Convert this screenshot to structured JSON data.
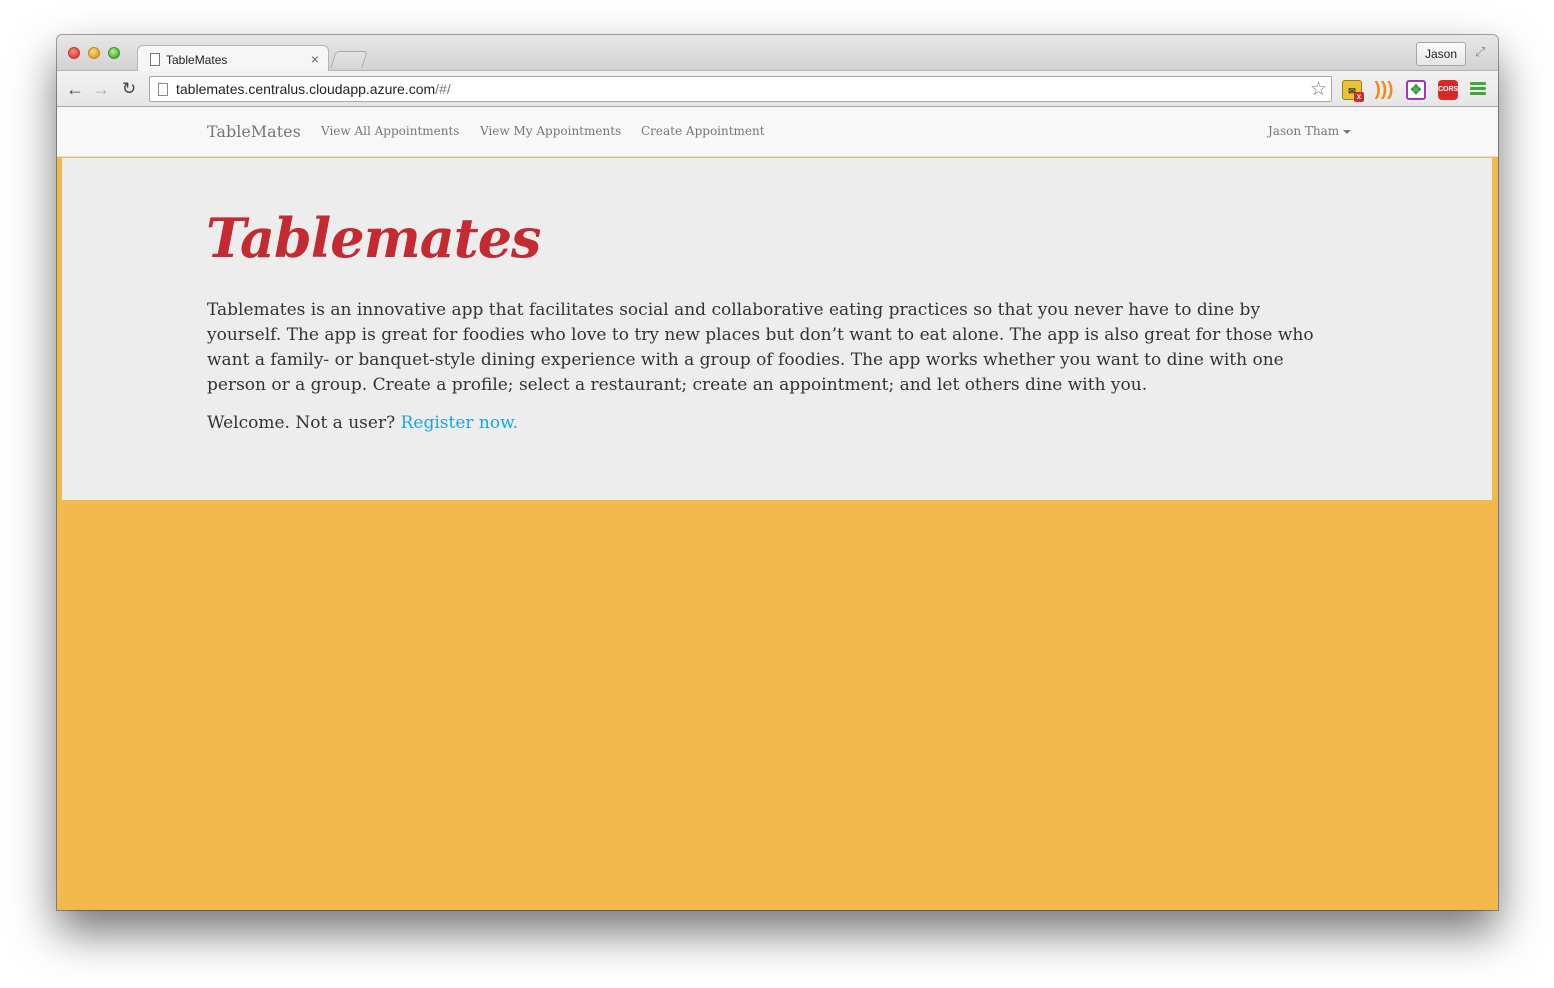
{
  "browser": {
    "tab_title": "TableMates",
    "tab_close": "×",
    "profile_name": "Jason",
    "url_host": "tablemates.centralus.cloudapp.azure.com",
    "url_path": "/#/"
  },
  "icons": {
    "back": "back-arrow-icon",
    "forward": "forward-arrow-icon",
    "reload": "reload-icon",
    "bookmark": "star-icon",
    "extensions": [
      "mail-checker-icon",
      "rss-icon",
      "move-extension-icon",
      "cors-icon"
    ],
    "menu": "hamburger-menu-icon"
  },
  "navbar": {
    "brand": "TableMates",
    "links": [
      "View All Appointments",
      "View My Appointments",
      "Create Appointment"
    ],
    "user": "Jason Tham"
  },
  "hero": {
    "title": "Tablemates",
    "description": "Tablemates is an innovative app that facilitates social and collaborative eating practices so that you never have to dine by yourself. The app is great for foodies who love to try new places but don’t want to eat alone. The app is also great for those who want a family- or banquet-style dining experience with a group of foodies. The app works whether you want to dine with one person or a group. Create a profile; select a restaurant; create an appointment; and let others dine with you.",
    "welcome_text": "Welcome. Not a user?",
    "register_link": "Register now."
  },
  "colors": {
    "page_background": "#f3b94d",
    "hero_background": "#ededed",
    "title_red": "#c32a32",
    "link_blue": "#18a5e6"
  }
}
